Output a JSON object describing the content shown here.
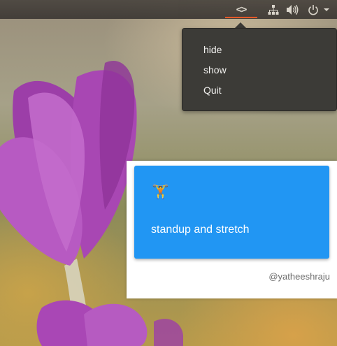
{
  "panel": {
    "app_indicator_glyph": "<>",
    "app_indicator_icon": "code-brackets-icon",
    "network_icon": "network-icon",
    "sound_icon": "speaker-volume-icon",
    "power_icon": "power-icon",
    "accent_color": "#e95420"
  },
  "menu": {
    "items": [
      {
        "label": "hide"
      },
      {
        "label": "show"
      },
      {
        "label": "Quit"
      }
    ]
  },
  "notification": {
    "emoji": "🏋️",
    "emoji_icon": "weightlifter-icon",
    "message": "standup and stretch",
    "credit": "@yatheeshraju",
    "card_color": "#2196f3"
  }
}
